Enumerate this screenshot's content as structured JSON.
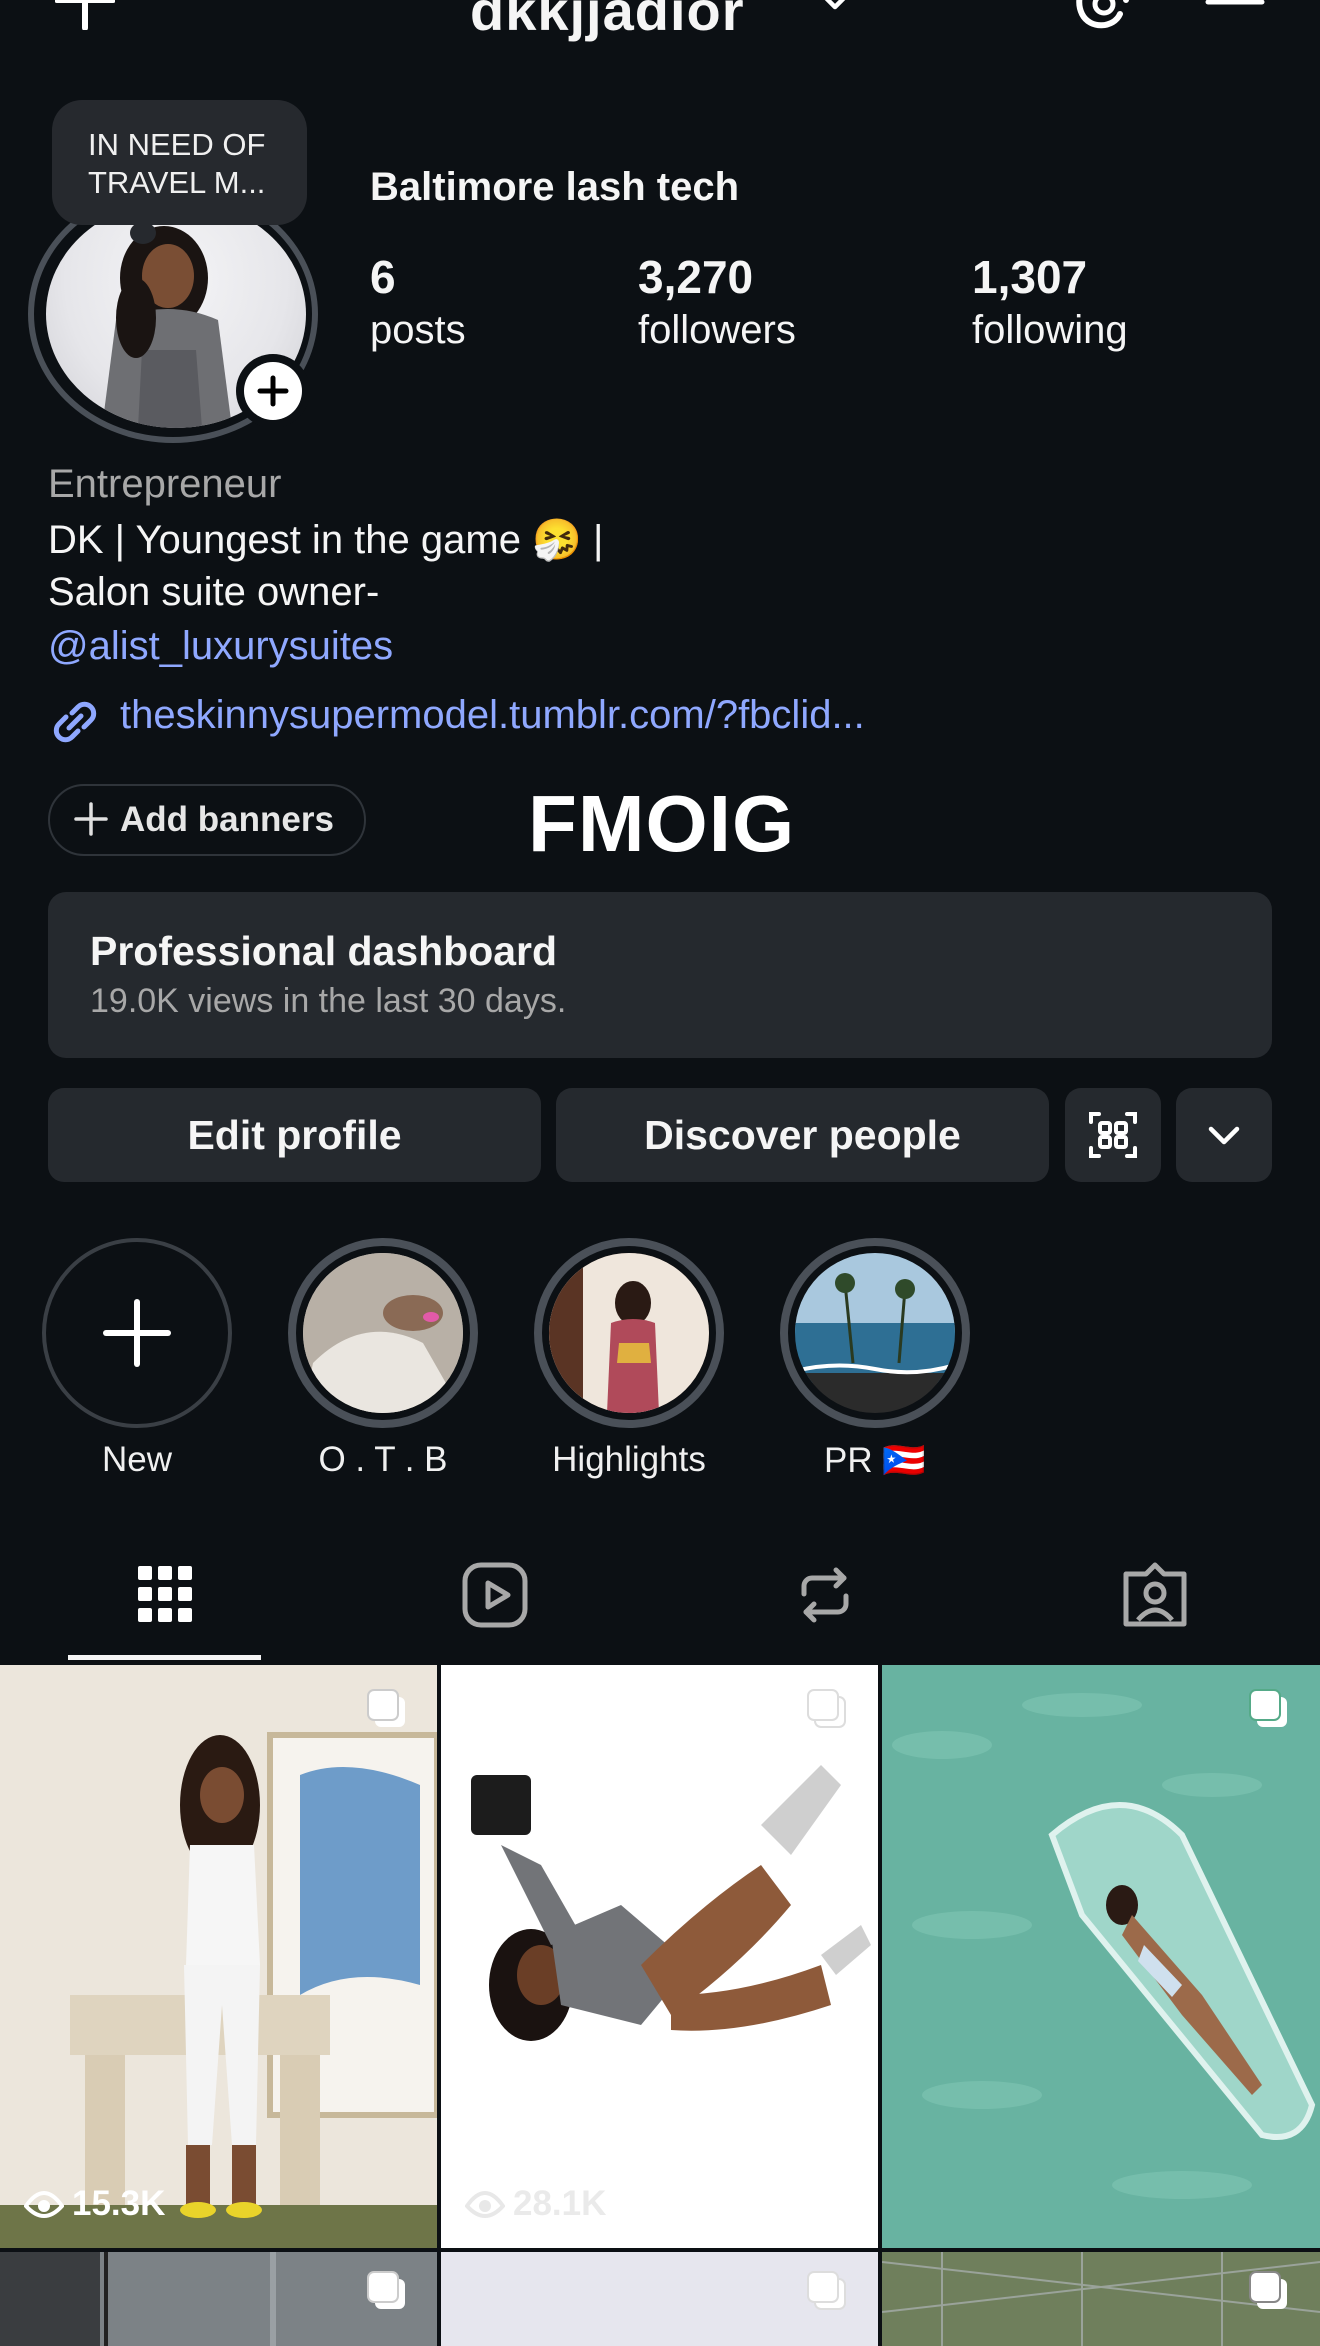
{
  "header": {
    "username": "dkkjjadior",
    "icons": [
      "plus-icon",
      "chevron-down-icon",
      "threads-icon",
      "menu-icon"
    ]
  },
  "profile": {
    "note": "IN NEED OF TRAVEL M...",
    "full_name": "Baltimore lash tech",
    "stats": {
      "posts_count": "6",
      "posts_label": "posts",
      "followers_count": "3,270",
      "followers_label": "followers",
      "following_count": "1,307",
      "following_label": "following"
    },
    "category": "Entrepreneur",
    "bio_line1": "DK | Youngest in the game 🤧 |",
    "bio_line2": "Salon suite owner-",
    "bio_mention": "@alist_luxurysuites",
    "link": "theskinnysupermodel.tumblr.com/?fbclid..."
  },
  "add_banners_label": "Add banners",
  "watermark": "FMOIG",
  "dashboard": {
    "title": "Professional dashboard",
    "subtitle": "19.0K views in the last 30 days."
  },
  "actions": {
    "edit_profile": "Edit profile",
    "discover_people": "Discover people"
  },
  "highlights": [
    {
      "label": "New"
    },
    {
      "label": "O . T . B"
    },
    {
      "label": "Highlights"
    },
    {
      "label": "PR 🇵🇷"
    }
  ],
  "tabs": [
    "grid-icon",
    "reels-icon",
    "reposts-icon",
    "tagged-icon"
  ],
  "grid": [
    {
      "views": "15.3K"
    },
    {
      "views": "28.1K"
    },
    {
      "views": ""
    }
  ],
  "colors": {
    "background": "#0c1014",
    "surface": "#25292e",
    "link": "#8fa8ff",
    "muted": "#a8a8a8"
  }
}
